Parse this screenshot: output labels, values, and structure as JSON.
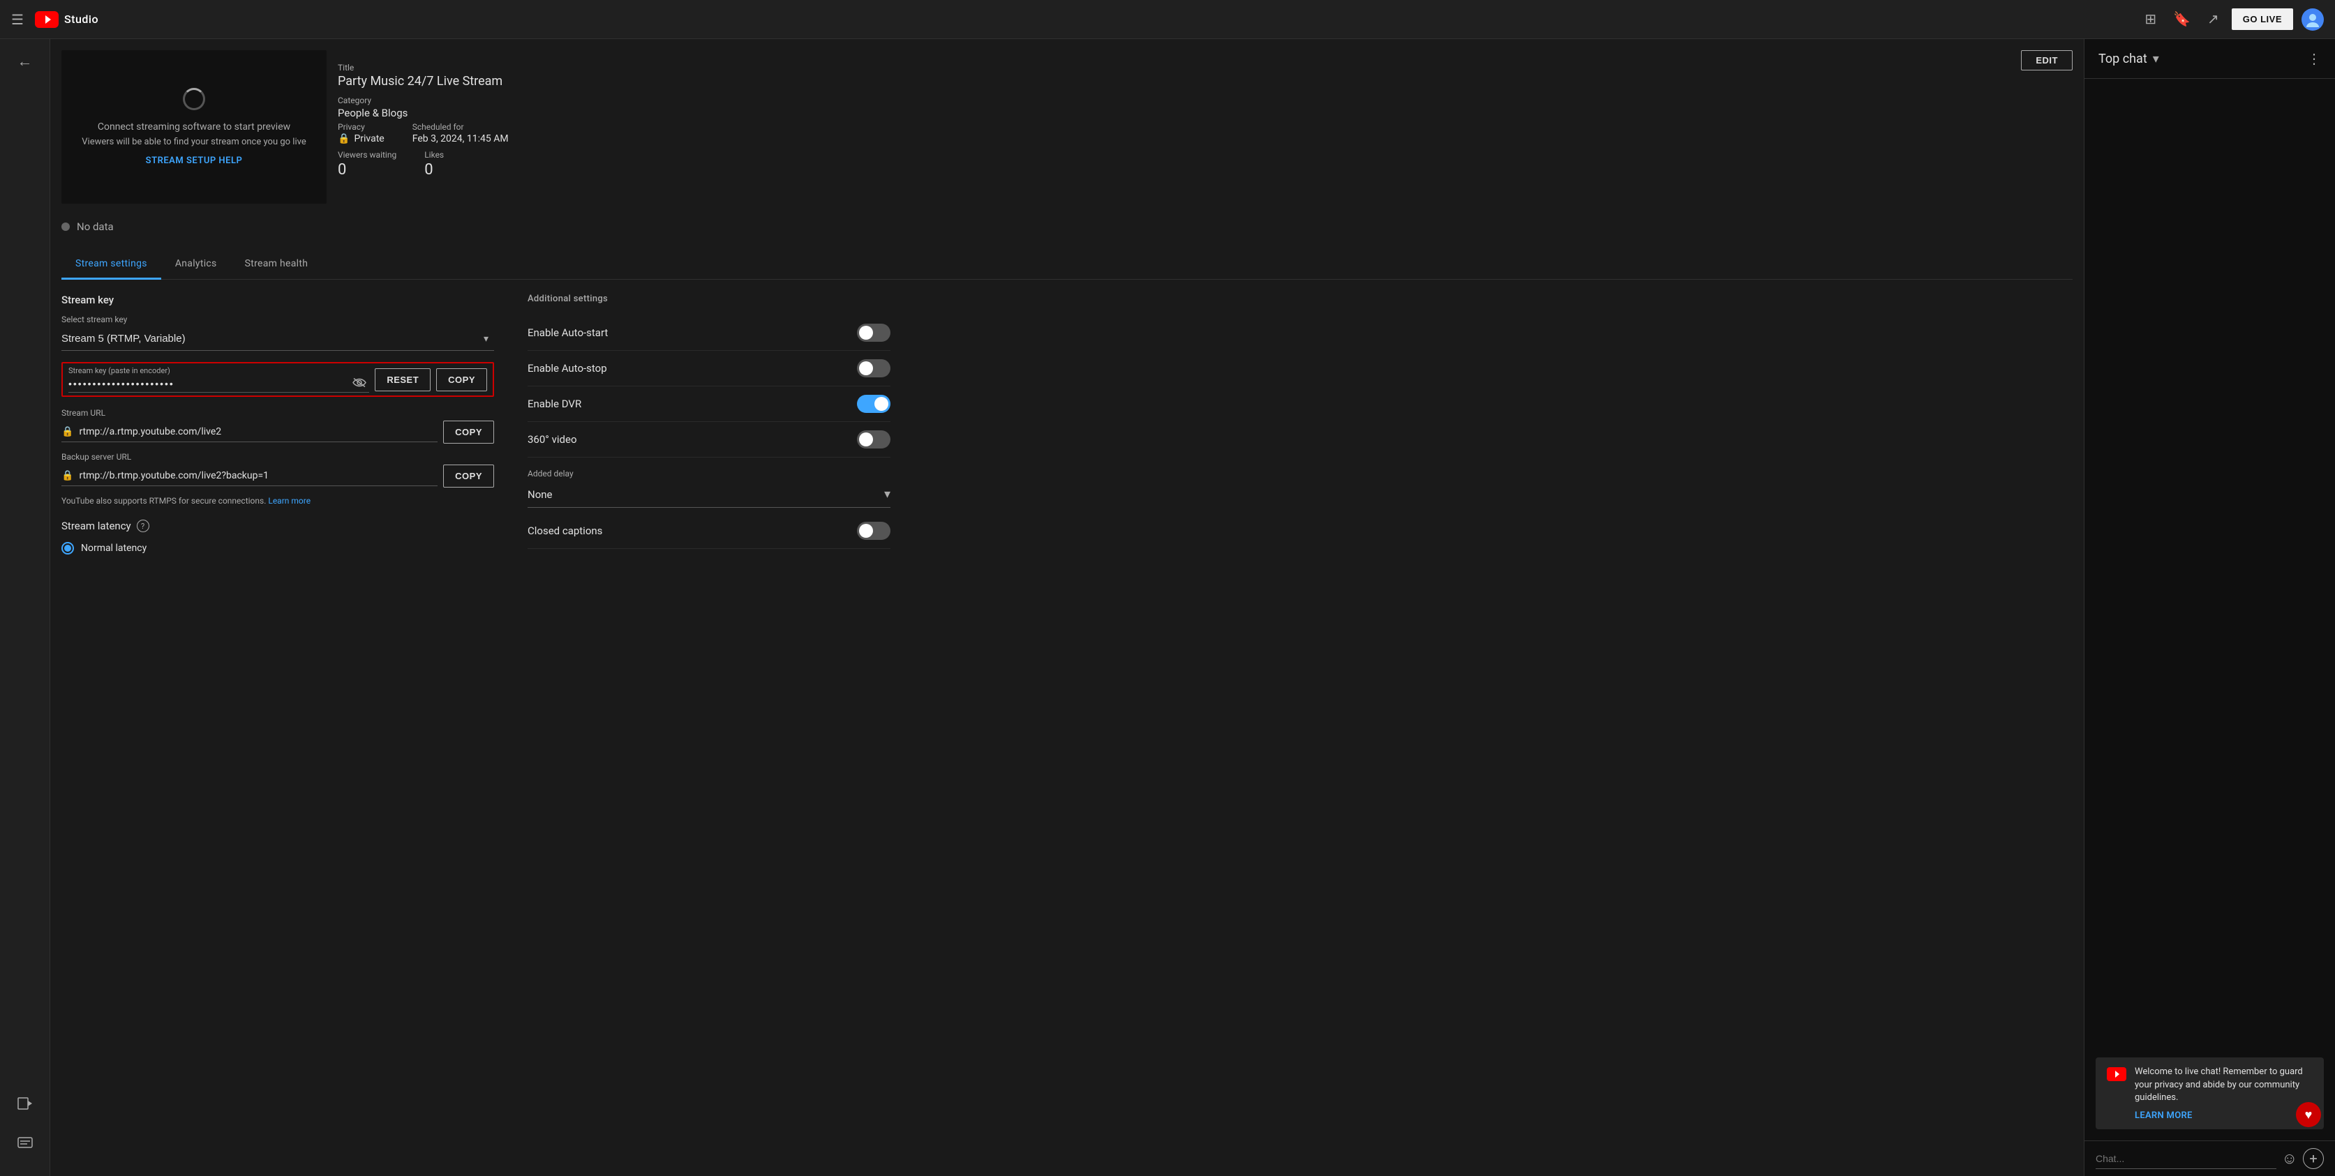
{
  "nav": {
    "hamburger_label": "☰",
    "studio_text": "Studio",
    "go_live_label": "GO LIVE"
  },
  "preview": {
    "text1": "Connect streaming software to start preview",
    "text2": "Viewers will be able to find your stream once you go live",
    "setup_link": "STREAM SETUP HELP"
  },
  "stream_info": {
    "title_label": "Title",
    "title_value": "Party Music 24/7 Live Stream",
    "edit_label": "EDIT",
    "category_label": "Category",
    "category_value": "People & Blogs",
    "privacy_label": "Privacy",
    "privacy_value": "Private",
    "scheduled_label": "Scheduled for",
    "scheduled_value": "Feb 3, 2024, 11:45 AM",
    "viewers_label": "Viewers waiting",
    "viewers_value": "0",
    "likes_label": "Likes",
    "likes_value": "0"
  },
  "no_data": {
    "text": "No data"
  },
  "tabs": {
    "items": [
      {
        "label": "Stream settings",
        "active": true
      },
      {
        "label": "Analytics",
        "active": false
      },
      {
        "label": "Stream health",
        "active": false
      }
    ]
  },
  "stream_key_section": {
    "section_title": "Stream key",
    "select_label": "Select stream key",
    "select_value": "Stream 5 (RTMP, Variable)",
    "key_field_label": "Stream key (paste in encoder)",
    "key_value": "••••••••••••••••••••••",
    "reset_label": "RESET",
    "copy_key_label": "COPY",
    "url_label": "Stream URL",
    "url_value": "rtmp://a.rtmp.youtube.com/live2",
    "copy_url_label": "COPY",
    "backup_label": "Backup server URL",
    "backup_value": "rtmp://b.rtmp.youtube.com/live2?backup=1",
    "copy_backup_label": "COPY",
    "rtmps_note": "YouTube also supports RTMPS for secure connections.",
    "learn_more_label": "Learn more"
  },
  "stream_latency": {
    "title": "Stream latency",
    "option_label": "Normal latency"
  },
  "additional_settings": {
    "title": "Additional settings",
    "toggles": [
      {
        "label": "Enable Auto-start",
        "state": "off"
      },
      {
        "label": "Enable Auto-stop",
        "state": "off"
      },
      {
        "label": "Enable DVR",
        "state": "on"
      },
      {
        "label": "360° video",
        "state": "off"
      }
    ],
    "delay_label": "Added delay",
    "delay_value": "None",
    "captions_label": "Closed captions",
    "captions_state": "off"
  },
  "chat": {
    "header_title": "Top chat",
    "welcome_text": "Welcome to live chat! Remember to guard your privacy and abide by our community guidelines.",
    "learn_more_label": "LEARN MORE",
    "input_placeholder": "Chat...",
    "heart_icon": "♥"
  }
}
